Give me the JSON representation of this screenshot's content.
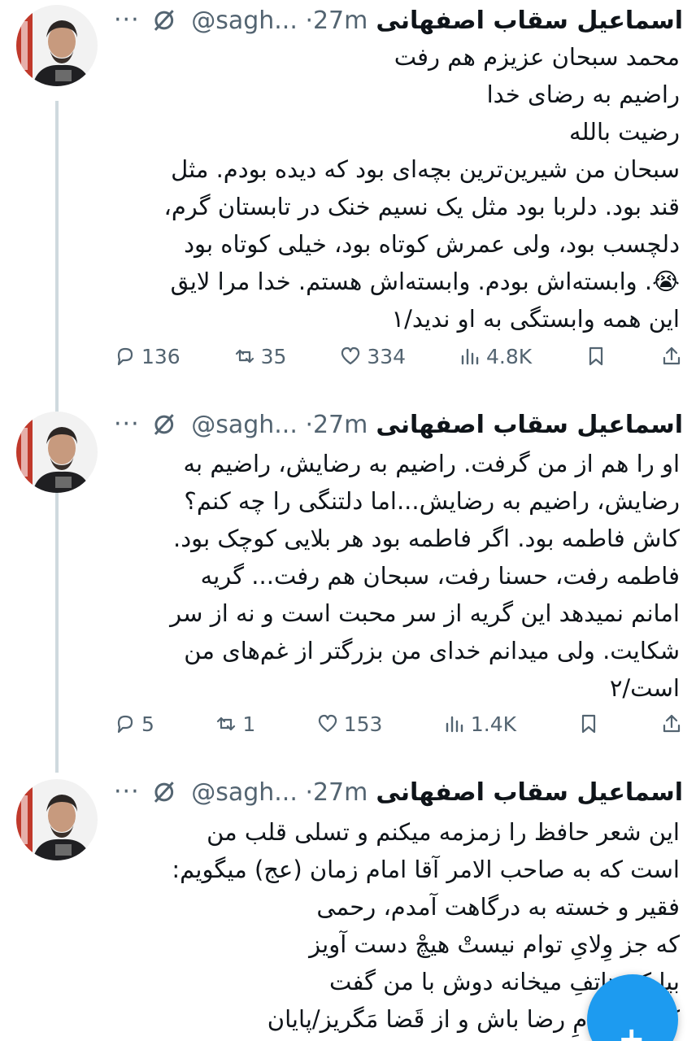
{
  "thread": [
    {
      "author": {
        "name": "اسماعیل سقاب اصفهانی",
        "handle": "@sagh...",
        "time": "·27m"
      },
      "more_label": "···",
      "lines": [
        "محمد سبحان عزیزم هم رفت",
        "راضیم به رضای خدا",
        "رضیت بالله",
        "سبحان من شیرین‌ترین بچه‌ای بود که دیده بودم. مثل",
        "قند بود. دلربا بود مثل یک نسیم خنک در تابستان گرم،",
        "دلچسب بود، ولی عمرش کوتاه بود، خیلی کوتاه بود",
        "😭. وابسته‌اش بودم. وابسته‌اش هستم. خدا مرا لایق",
        "این همه وابستگی به او ندید/۱"
      ],
      "stats": {
        "replies": "136",
        "reposts": "35",
        "likes": "334",
        "views": "4.8K"
      }
    },
    {
      "author": {
        "name": "اسماعیل سقاب اصفهانی",
        "handle": "@sagh...",
        "time": "·27m"
      },
      "more_label": "···",
      "lines": [
        "او را هم از من گرفت. راضیم به رضایش، راضیم به",
        "رضایش، راضیم به رضایش...اما دلتنگی را چه کنم؟",
        "کاش فاطمه بود. اگر فاطمه بود هر بلایی کوچک بود.",
        "فاطمه رفت، حسنا رفت، سبحان هم رفت... گریه",
        "امانم نمیدهد این گریه از سر محبت است و نه از سر",
        "شکایت. ولی میدانم خدای من بزرگتر از غم‌های من",
        "است/۲"
      ],
      "stats": {
        "replies": "5",
        "reposts": "1",
        "likes": "153",
        "views": "1.4K"
      }
    },
    {
      "author": {
        "name": "اسماعیل سقاب اصفهانی",
        "handle": "@sagh...",
        "time": "·27m"
      },
      "more_label": "···",
      "lines": [
        "این شعر حافظ  را زمزمه میکنم و تسلی قلب من",
        "است که به صاحب الامر آقا امام زمان (عج) میگویم:",
        "فقیر و خسته به درگاهت آمدم، رحمی",
        "که جز وِلایِ توام نیستْ هیچْ دست آویز",
        "بیا که هاتفِ میخانه دوش با من گفت",
        "که در مَقامِ رضا باش و از قَضا مَگریز/پایان"
      ]
    }
  ],
  "colors": {
    "text": "#0f1419",
    "secondary": "#536471",
    "thread_line": "#cfd9de",
    "accent": "#1d9bf0"
  },
  "fab": {
    "icon": "+"
  }
}
